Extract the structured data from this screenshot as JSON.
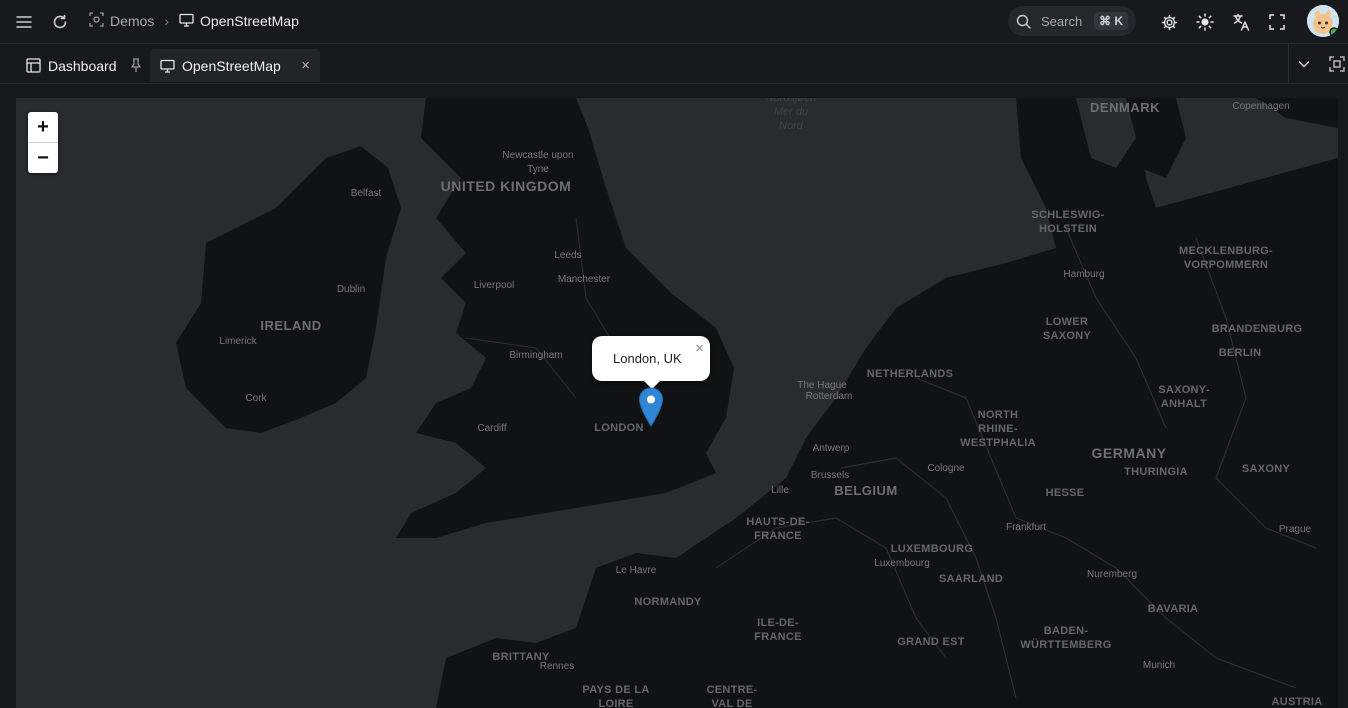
{
  "header": {
    "breadcrumb": [
      {
        "label": "Demos"
      },
      {
        "label": "OpenStreetMap"
      }
    ],
    "search_placeholder": "Search",
    "search_shortcut": "⌘ K"
  },
  "tabs": [
    {
      "label": "Dashboard",
      "active": false
    },
    {
      "label": "OpenStreetMap",
      "active": true
    }
  ],
  "map": {
    "zoom_in": "+",
    "zoom_out": "−",
    "popup_text": "London, UK",
    "popup_close": "×",
    "labels": {
      "uk": "UNITED KINGDOM",
      "ireland": "IRELAND",
      "denmark": "DENMARK",
      "netherlands": "NETHERLANDS",
      "belgium": "BELGIUM",
      "germany": "GERMANY",
      "austria": "AUSTRIA",
      "luxembourg": "LUXEMBOURG",
      "schleswig": "SCHLESWIG-\nHOLSTEIN",
      "mecklenburg": "MECKLENBURG-\nVORPOMMERN",
      "lower_saxony": "LOWER\nSAXONY",
      "brandenburg": "BRANDENBURG",
      "saxony_anhalt": "SAXONY-\nANHALT",
      "nrw": "NORTH\nRHINE-\nWESTPHALIA",
      "thuringia": "THURINGIA",
      "saxony": "SAXONY",
      "hesse": "HESSE",
      "saarland": "SAARLAND",
      "bavaria": "BAVARIA",
      "bw": "BADEN-\nWÜRTTEMBERG",
      "hauts": "HAUTS-DE-\nFRANCE",
      "normandy": "NORMANDY",
      "ile": "ILE-DE-\nFRANCE",
      "grand_est": "GRAND EST",
      "brittany": "BRITTANY",
      "pays": "PAYS DE LA\nLOIRE",
      "centre": "CENTRE-\nVAL DE",
      "london": "LONDON",
      "nordsee": "Nordsjøen\nMer du\nNord",
      "newcastle": "Newcastle upon\nTyne",
      "belfast": "Belfast",
      "leeds": "Leeds",
      "manchester": "Manchester",
      "liverpool": "Liverpool",
      "dublin": "Dublin",
      "limerick": "Limerick",
      "cork": "Cork",
      "birmingham": "Birmingham",
      "cardiff": "Cardiff",
      "hague": "The Hague",
      "rotterdam": "Rotterdam",
      "antwerp": "Antwerp",
      "brussels": "Brussels",
      "lille": "Lille",
      "cologne": "Cologne",
      "hamburg": "Hamburg",
      "berlin": "BERLIN",
      "copenhagen": "Copenhagen",
      "frankfurt": "Frankfurt",
      "luxembourg_city": "Luxembourg",
      "nuremberg": "Nuremberg",
      "prague": "Prague",
      "munich": "Munich",
      "le_havre": "Le Havre",
      "rennes": "Rennes"
    }
  },
  "colors": {
    "background": "#17181b",
    "land": "#111214",
    "water": "#2a2b2e",
    "marker": "#2e86d4"
  },
  "icons": [
    "menu-icon",
    "refresh-icon",
    "demos-icon",
    "monitor-icon",
    "search-icon",
    "settings-icon",
    "sun-icon",
    "translate-icon",
    "fullscreen-icon",
    "dashboard-icon",
    "pin-icon",
    "close-icon",
    "chevron-down-icon",
    "screenshot-icon"
  ]
}
